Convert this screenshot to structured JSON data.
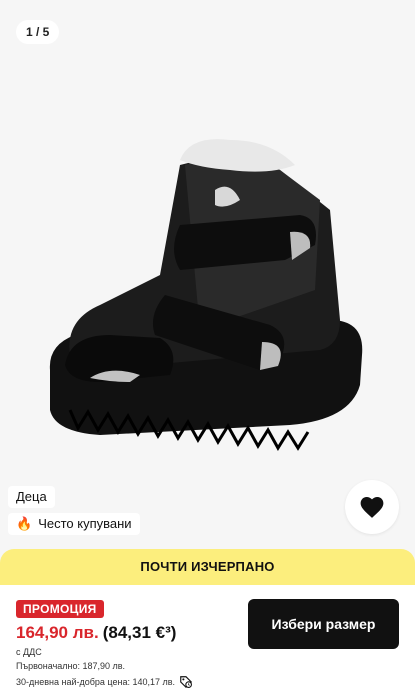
{
  "gallery": {
    "counter": "1 / 5"
  },
  "tags": {
    "category": "Деца",
    "popular": "Често купувани"
  },
  "banner": {
    "text": "ПОЧТИ ИЗЧЕРПАНО"
  },
  "price": {
    "promo_label": "ПРОМОЦИЯ",
    "current": "164,90 лв.",
    "euro": "(84,31 €³)",
    "vat_note": "с ДДС",
    "original": "Първоначално: 187,90 лв.",
    "best_30": "30-дневна най-добра цена: 140,17 лв."
  },
  "actions": {
    "select_size": "Избери размер"
  },
  "colors": {
    "promo_red": "#d9262c",
    "banner_yellow": "#fcee7d",
    "button_black": "#111111"
  },
  "icons": {
    "favorite": "heart-icon",
    "popular": "fire-icon",
    "info": "price-tag-icon"
  }
}
